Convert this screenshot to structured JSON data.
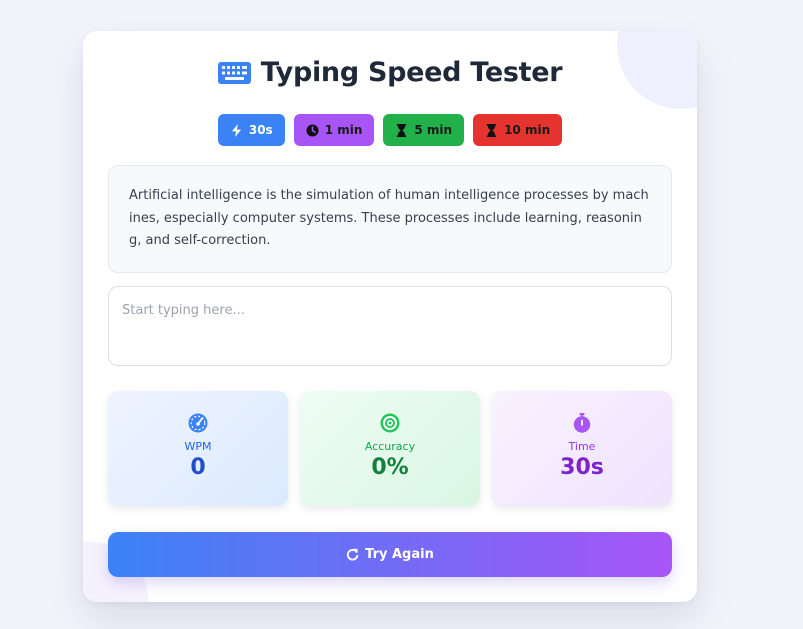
{
  "header": {
    "title": "Typing Speed Tester",
    "icon": "keyboard-icon"
  },
  "modes": [
    {
      "label": "30s",
      "icon": "bolt-icon",
      "color": "#3b82f6",
      "selected": true
    },
    {
      "label": "1 min",
      "icon": "clock-icon",
      "color": "#a855f7",
      "selected": false
    },
    {
      "label": "5 min",
      "icon": "hourglass-icon",
      "color": "#22b04a",
      "selected": false
    },
    {
      "label": "10 min",
      "icon": "hourglass-icon",
      "color": "#e5332f",
      "selected": false
    }
  ],
  "passage": {
    "text": "Artificial intelligence is the simulation of human intelligence processes by machines, especially computer systems. These processes include learning, reasoning, and self-correction."
  },
  "input": {
    "value": "",
    "placeholder": "Start typing here..."
  },
  "stats": {
    "wpm": {
      "label": "WPM",
      "value": "0",
      "icon": "gauge-icon",
      "color": "#2563eb"
    },
    "accuracy": {
      "label": "Accuracy",
      "value": "0%",
      "icon": "target-icon",
      "color": "#16a34a"
    },
    "time": {
      "label": "Time",
      "value": "30s",
      "icon": "stopwatch-icon",
      "color": "#9333ea"
    }
  },
  "actions": {
    "retry_label": "Try Again",
    "retry_icon": "redo-icon"
  }
}
